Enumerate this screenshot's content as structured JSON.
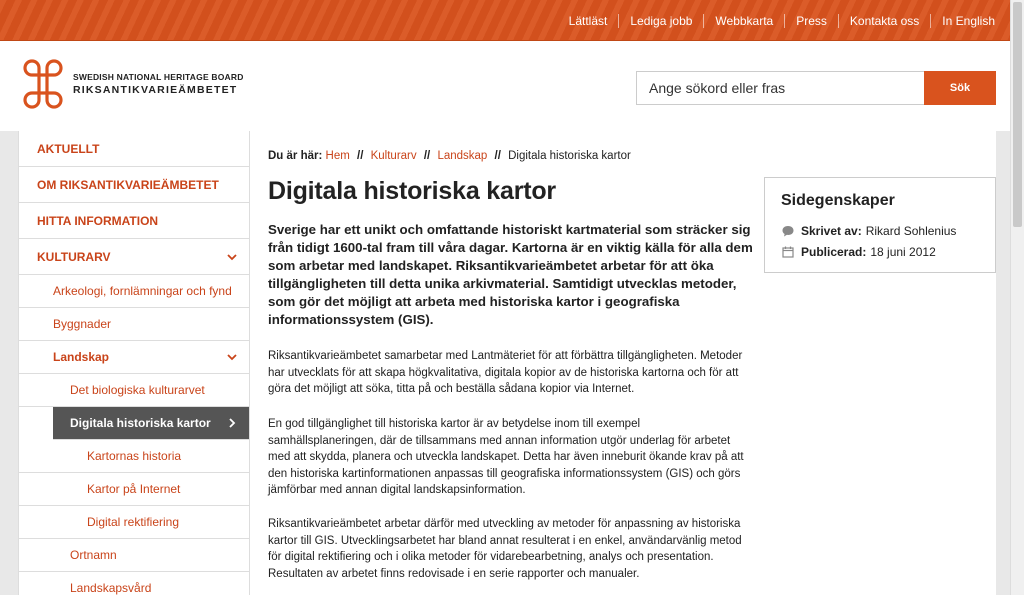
{
  "topnav": {
    "items": [
      "Lättläst",
      "Lediga jobb",
      "Webbkarta",
      "Press",
      "Kontakta oss",
      "In English"
    ]
  },
  "logo": {
    "line1": "SWEDISH NATIONAL HERITAGE BOARD",
    "line2": "RIKSANTIKVARIEÄMBETET"
  },
  "search": {
    "placeholder": "Ange sökord eller fras",
    "button": "Sök"
  },
  "sidebar": {
    "top": [
      "AKTUELLT",
      "OM RIKSANTIKVARIEÄMBETET",
      "HITTA INFORMATION",
      "KULTURARV"
    ],
    "sub": {
      "arkeologi": "Arkeologi, fornlämningar och fynd",
      "byggnader": "Byggnader",
      "landskap": "Landskap",
      "biologiska": "Det biologiska kulturarvet",
      "digitala": "Digitala historiska kartor",
      "kartornas": "Kartornas historia",
      "internet": "Kartor på Internet",
      "rektifiering": "Digital rektifiering",
      "ortnamn": "Ortnamn",
      "landskapsvard": "Landskapsvård"
    }
  },
  "breadcrumb": {
    "label": "Du är här:",
    "links": [
      "Hem",
      "Kulturarv",
      "Landskap"
    ],
    "separator": "//",
    "current": "Digitala historiska kartor"
  },
  "page": {
    "title": "Digitala historiska kartor",
    "lead": "Sverige har ett unikt och omfattande historiskt kartmaterial som sträcker sig från tidigt 1600-tal fram till våra dagar. Kartorna är en viktig källa för alla dem som arbetar med landskapet. Riksantikvarieämbetet arbetar för att öka tillgängligheten till detta unika arkivmaterial. Samtidigt utvecklas metoder, som gör det möjligt att arbeta med historiska kartor i geografiska informationssystem (GIS).",
    "paragraphs": [
      "Riksantikvarieämbetet samarbetar med Lantmäteriet för att förbättra tillgängligheten. Metoder har utvecklats för att skapa högkvalitativa, digitala kopior av de historiska kartorna och för att göra det möjligt att söka, titta på och beställa sådana kopior via Internet.",
      "En god tillgänglighet till historiska kartor är av betydelse inom till exempel samhällsplaneringen, där de tillsammans med annan information utgör underlag för arbetet med att skydda, planera och utveckla landskapet. Detta har även inneburit ökande krav på att den historiska kartinformationen anpassas till geografiska informationssystem (GIS) och görs jämförbar med annan digital landskapsinformation.",
      "Riksantikvarieämbetet arbetar därför med utveckling av metoder för anpassning av historiska kartor till GIS. Utvecklingsarbetet har bland annat resulterat i en enkel, användarvänlig metod för digital rektifiering och i olika metoder för vidarebearbetning, analys och presentation. Resultaten av arbetet finns redovisade i en serie rapporter och manualer."
    ]
  },
  "aside": {
    "title": "Sidegenskaper",
    "author_label": "Skrivet av:",
    "author": "Rikard Sohlenius",
    "published_label": "Publicerad:",
    "published": "18 juni 2012"
  },
  "colors": {
    "accent": "#d9531e",
    "link": "#c9441a",
    "active_bg": "#555555"
  }
}
